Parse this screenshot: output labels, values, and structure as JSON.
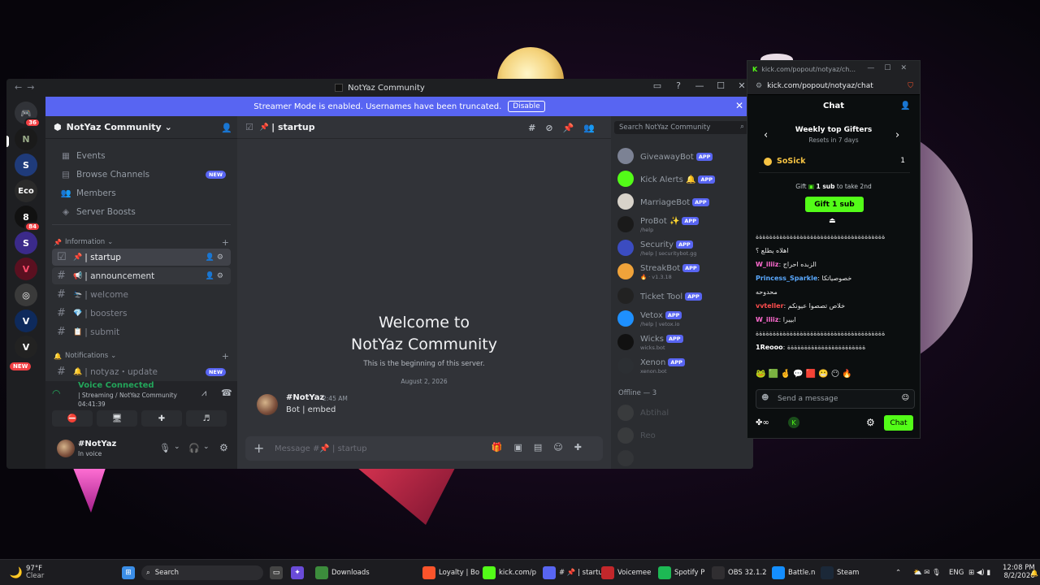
{
  "discord": {
    "window_title": "NotYaz Community",
    "streamer_banner": {
      "text": "Streamer Mode is enabled. Usernames have been truncated.",
      "disable_label": "Disable"
    },
    "server": {
      "name": "NotYaz Community",
      "menu_items": [
        {
          "label": "Events",
          "icon": "calendar-icon"
        },
        {
          "label": "Browse Channels",
          "icon": "browse-icon",
          "badge": "NEW"
        },
        {
          "label": "Members",
          "icon": "members-icon"
        },
        {
          "label": "Server Boosts",
          "icon": "boost-icon"
        }
      ],
      "categories": {
        "information": {
          "label": "Information",
          "emoji": "📌",
          "channels": [
            {
              "name": "startup",
              "emoji": "📌"
            },
            {
              "name": "announcement",
              "emoji": "📢"
            },
            {
              "name": "welcome",
              "emoji": "🛬"
            },
            {
              "name": "boosters",
              "emoji": "💎"
            },
            {
              "name": "submit",
              "emoji": "📋"
            }
          ]
        },
        "notifications": {
          "label": "Notifications",
          "emoji": "🔔",
          "channels": [
            {
              "name": "notyaz・update",
              "emoji": "🔔",
              "badge": "NEW"
            }
          ]
        }
      }
    },
    "guild_badges": {
      "home": "36",
      "server_red": "84",
      "new_label": "NEW"
    },
    "voice": {
      "status": "Voice Connected",
      "subtitle": "| Streaming / NotYaz Community",
      "timer": "04:41:39"
    },
    "user": {
      "name": "#NotYaz",
      "status": "In voice"
    },
    "channel_header": {
      "name": "startup",
      "emoji": "📌"
    },
    "welcome": {
      "line1": "Welcome to",
      "line2": "NotYaz Community",
      "sub": "This is the beginning of this server.",
      "date": "August 2, 2026"
    },
    "message": {
      "author": "#NotYaz",
      "time": "2:45 AM",
      "text": "Bot | embed"
    },
    "composer_placeholder": "Message #📌 | startup",
    "member_search": "Search NotYaz Community",
    "members": [
      {
        "name": "GiveawayBot",
        "sub": "",
        "app": "APP",
        "color": "#7c8294"
      },
      {
        "name": "Kick Alerts 🔔",
        "sub": "",
        "app": "APP",
        "color": "#53fc18"
      },
      {
        "name": "MarriageBot",
        "sub": "",
        "app": "APP",
        "color": "#d8d3ca"
      },
      {
        "name": "ProBot ✨",
        "sub": "/help",
        "app": "APP",
        "color": "#1a1a1a"
      },
      {
        "name": "Security",
        "sub": "/help | securitybot.gg",
        "app": "APP",
        "color": "#3b4cc0"
      },
      {
        "name": "StreakBot",
        "sub": "🔥 · v1.3.18",
        "app": "APP",
        "color": "#f0a33a"
      },
      {
        "name": "Ticket Tool",
        "sub": "",
        "app": "APP",
        "color": "#222222"
      },
      {
        "name": "Vetox",
        "sub": "/help | vetox.io",
        "app": "APP",
        "color": "#1e90ff"
      },
      {
        "name": "Wicks",
        "sub": "wicks.bot",
        "app": "APP",
        "color": "#111111"
      },
      {
        "name": "Xenon",
        "sub": "xenon.bot",
        "app": "APP",
        "color": "#2c2f33"
      }
    ],
    "offline": {
      "header": "Offline — 3",
      "names": [
        "Abtihal",
        "Reo"
      ]
    }
  },
  "kick": {
    "window_title": "kick.com/popout/notyaz/ch...",
    "url": "kick.com/popout/notyaz/chat",
    "chat_title": "Chat",
    "gifters": {
      "title": "Weekly top Gifters",
      "sub": "Resets in 7 days"
    },
    "top_user": {
      "name": "SoSick",
      "count": "1"
    },
    "gift_prompt": {
      "pre": "Gift",
      "bold": "1 sub",
      "post": "to take 2nd"
    },
    "gift_button": "Gift 1 sub",
    "messages": [
      {
        "user": "",
        "text": "ةةةةةةةةةةةةةةةةةةةةةةةةةةةةةةةةةةةةةة",
        "color": "#ffffff"
      },
      {
        "user": "",
        "text": "اهلاه يطلع ؟",
        "color": "#ffffff"
      },
      {
        "user": "W_iliiz",
        "text": "الزبده احراج",
        "color": "#ff6bd0"
      },
      {
        "user": "Princess_Sparkle",
        "text": "خصوصياتكا",
        "color": "#5aa9ff"
      },
      {
        "user": "",
        "text": "محدوحه",
        "color": "#ffffff"
      },
      {
        "user": "vvteller",
        "text": "خلاص تصصوا عيونكم",
        "color": "#ff4d4d"
      },
      {
        "user": "W_iliiz",
        "text": "ابييرا",
        "color": "#ff6bd0"
      },
      {
        "user": "",
        "text": "ةةةةةةةةةةةةةةةةةةةةةةةةةةةةةةةةةةةةةة",
        "color": "#ffffff"
      },
      {
        "user": "1Reooo",
        "text": "ةةةةةةةةةةةةةةةةةةةةةةة",
        "color": "#ffffff"
      }
    ],
    "input_placeholder": "Send a message",
    "chat_button": "Chat"
  },
  "taskbar": {
    "weather": {
      "temp": "97°F",
      "cond": "Clear"
    },
    "search_label": "Search",
    "apps": [
      {
        "label": "Downloads",
        "icon": "download-icon",
        "color": "#3c8c3c"
      },
      {
        "label": "Loyalty | Bo",
        "icon": "brave-icon",
        "color": "#fb542b"
      },
      {
        "label": "kick.com/p",
        "icon": "kick-icon",
        "color": "#53fc18"
      },
      {
        "label": "# 📌 | startu",
        "icon": "discord-icon",
        "color": "#5865f2"
      },
      {
        "label": "Voicemee",
        "icon": "voicemeeter-icon",
        "color": "#c3272b"
      },
      {
        "label": "Spotify P",
        "icon": "spotify-icon",
        "color": "#1db954"
      },
      {
        "label": "OBS 32.1.2",
        "icon": "obs-icon",
        "color": "#302e31"
      },
      {
        "label": "Battle.n",
        "icon": "battlenet-icon",
        "color": "#148eff"
      },
      {
        "label": "Steam",
        "icon": "steam-icon",
        "color": "#1b2838"
      }
    ],
    "lang": "ENG",
    "time": "12:08 PM",
    "date": "8/2/2026"
  }
}
